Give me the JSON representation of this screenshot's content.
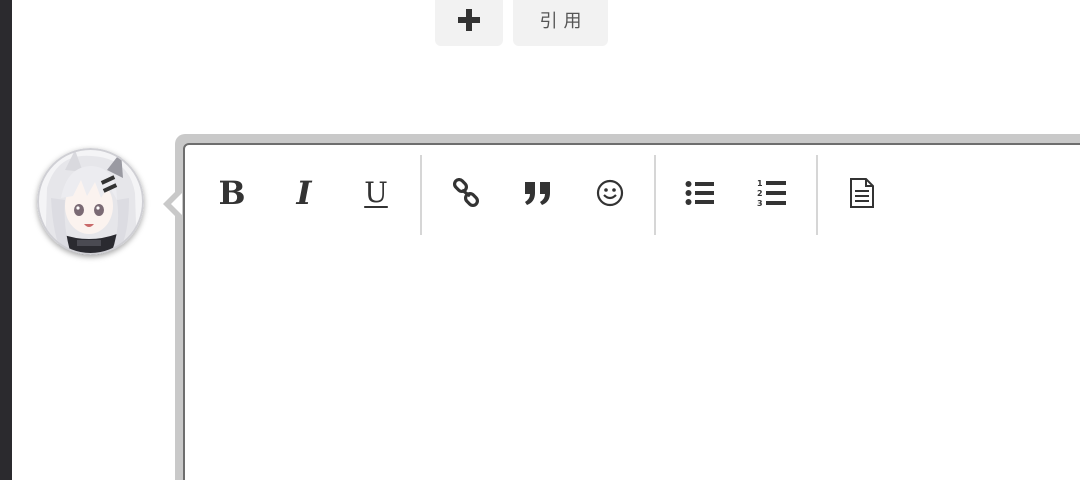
{
  "top_actions": {
    "add_icon": "plus-icon",
    "quote_label": "引用"
  },
  "user": {
    "avatar_icon": "anime-avatar"
  },
  "toolbar": {
    "bold_label": "B",
    "italic_label": "I",
    "underline_label": "U",
    "icons": [
      "link-icon",
      "quote-icon",
      "emoji-icon",
      "bullet-list-icon",
      "numbered-list-icon",
      "document-icon"
    ]
  },
  "editor": {
    "content": ""
  },
  "colors": {
    "icon": "#333333",
    "editor_border": "#6e6e6e",
    "editor_frame": "#c9c9c9",
    "button_bg": "#f2f2f2",
    "separator": "#d6d6d6"
  }
}
